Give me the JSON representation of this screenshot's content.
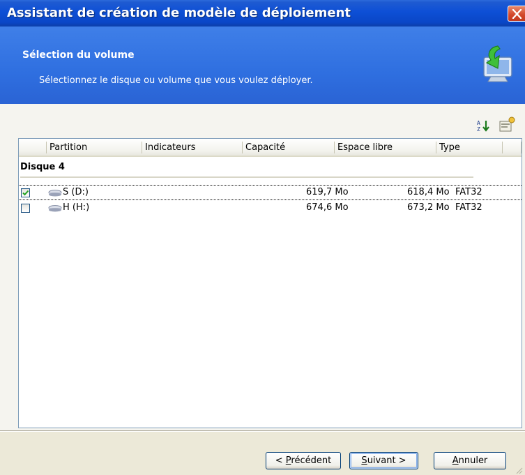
{
  "window": {
    "title": "Assistant de création de modèle de déploiement"
  },
  "header": {
    "title": "Sélection du volume",
    "subtitle": "Sélectionnez le disque ou volume que vous voulez déployer.",
    "icon": "monitor-green-arrow-icon"
  },
  "toolbar": {
    "icons": [
      "sort-icon",
      "properties-icon"
    ]
  },
  "list": {
    "columns": [
      "Partition",
      "Indicateurs",
      "Capacité",
      "Espace libre",
      "Type"
    ],
    "group": "Disque 4",
    "rows": [
      {
        "checked": true,
        "partition": "S (D:)",
        "indicateurs": "",
        "capacite": "619,7 Mo",
        "espace_libre": "618,4 Mo",
        "type": "FAT32",
        "selected": true
      },
      {
        "checked": false,
        "partition": "H (H:)",
        "indicateurs": "",
        "capacite": "674,6 Mo",
        "espace_libre": "673,2 Mo",
        "type": "FAT32",
        "selected": false
      }
    ]
  },
  "buttons": {
    "previous": {
      "prefix": "< ",
      "accel": "P",
      "rest": "récédent"
    },
    "next": {
      "accel": "S",
      "rest": "uivant >"
    },
    "cancel": {
      "accel": "A",
      "rest": "nnuler"
    }
  },
  "colors": {
    "titlebar": "#0a46c6",
    "header": "#2f6fe0",
    "close": "#d2452a",
    "face": "#ece9d8"
  }
}
